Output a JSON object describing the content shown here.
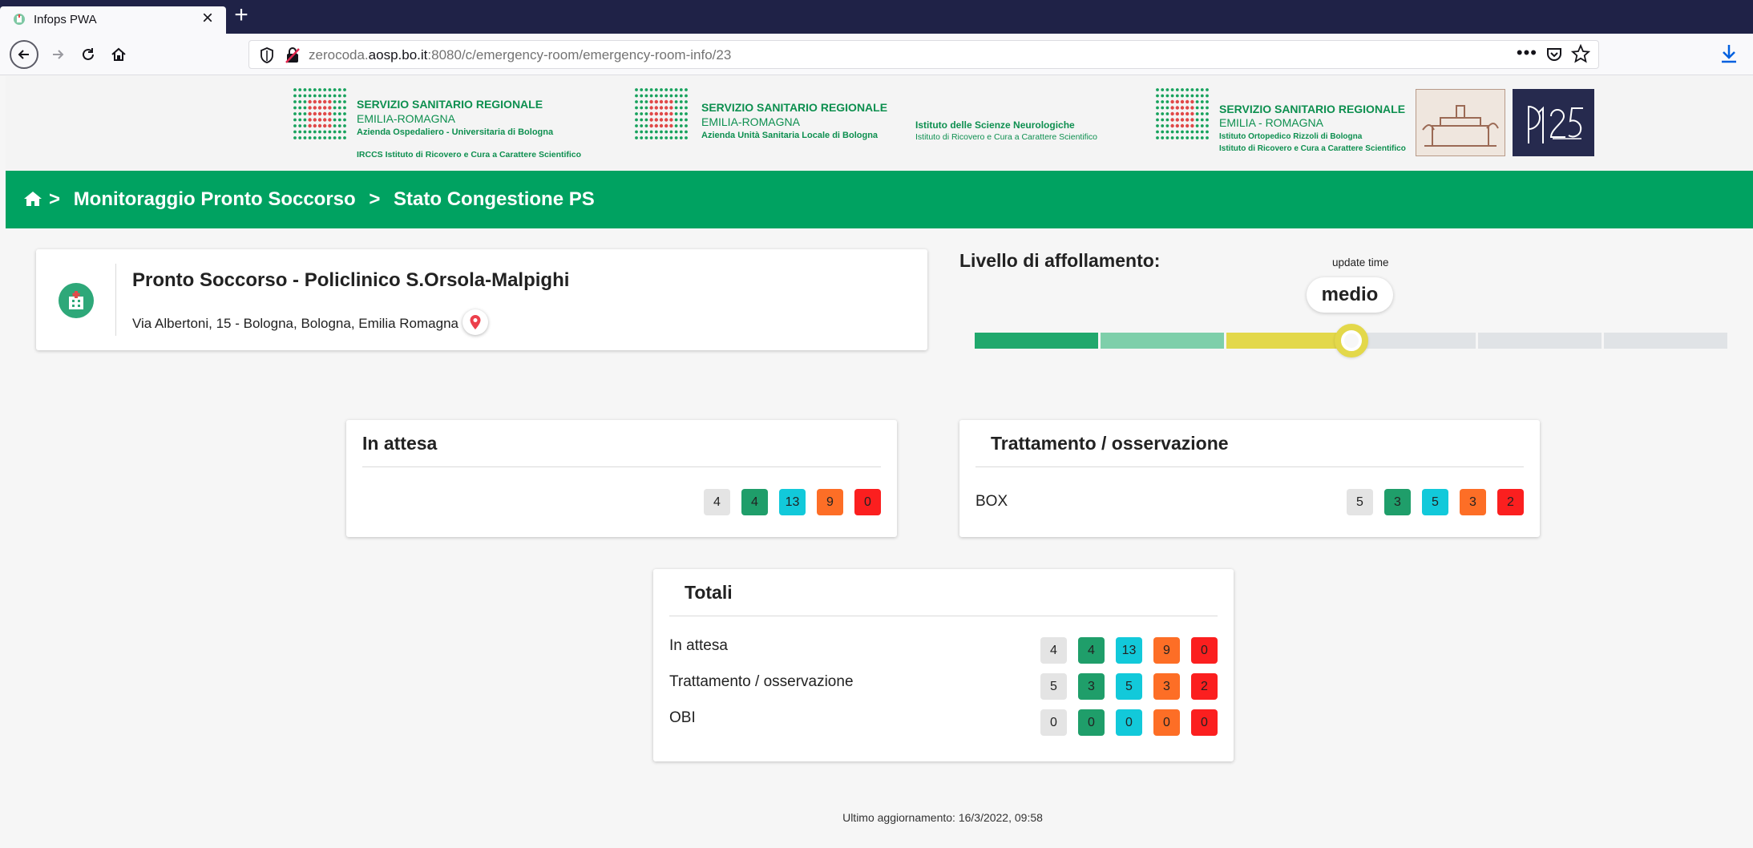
{
  "browser": {
    "tab_title": "Infops PWA",
    "url_prefix": "zerocoda.",
    "url_domain": "aosp.bo.it",
    "url_rest": ":8080/c/emergency-room/emergency-room-info/23",
    "more_label": "•••"
  },
  "logos": [
    {
      "line1": "SERVIZIO SANITARIO REGIONALE",
      "line2": "EMILIA-ROMAGNA",
      "line3": "Azienda Ospedaliero - Universitaria di Bologna",
      "line4": "IRCCS Istituto di Ricovero e Cura a Carattere Scientifico"
    },
    {
      "line1": "SERVIZIO SANITARIO REGIONALE",
      "line2": "EMILIA-ROMAGNA",
      "line3": "Azienda Unità Sanitaria Locale di Bologna",
      "neuro1": "Istituto delle Scienze Neurologiche",
      "neuro2": "Istituto di Ricovero e Cura a Carattere Scientifico"
    },
    {
      "line1": "SERVIZIO SANITARIO REGIONALE",
      "line2": "EMILIA - ROMAGNA",
      "line3": "Istituto Ortopedico Rizzoli di Bologna",
      "line4": "Istituto di Ricovero e Cura a Carattere Scientifico"
    }
  ],
  "breadcrumb": {
    "item1": "Monitoraggio Pronto Soccorso",
    "item2": "Stato Congestione PS",
    "separator": ">"
  },
  "hospital": {
    "name": "Pronto Soccorso - Policlinico S.Orsola-Malpighi",
    "address": "Via Albertoni, 15 - Bologna, Bologna, Emilia Romagna"
  },
  "crowding": {
    "title": "Livello di affollamento:",
    "update_label": "update time",
    "level_label": "medio",
    "level_fraction": 0.5,
    "segment_colors": [
      "#20a86d",
      "#7ecfaa",
      "#e3d84a",
      "#e0e3e6",
      "#e0e3e6",
      "#e0e3e6"
    ]
  },
  "colors": {
    "brand_green": "#00a261",
    "badge_grey": "#e4e4e4",
    "badge_green": "#1f9e6a",
    "badge_cyan": "#12c9da",
    "badge_orange": "#fd6e26",
    "badge_red": "#fb1f1f"
  },
  "in_attesa": {
    "title": "In attesa",
    "values": [
      "4",
      "4",
      "13",
      "9",
      "0"
    ]
  },
  "trattamento": {
    "title": "Trattamento / osservazione",
    "row_label": "BOX",
    "values": [
      "5",
      "3",
      "5",
      "3",
      "2"
    ]
  },
  "totali": {
    "title": "Totali",
    "rows": [
      {
        "label": "In attesa",
        "values": [
          "4",
          "4",
          "13",
          "9",
          "0"
        ]
      },
      {
        "label": "Trattamento / osservazione",
        "values": [
          "5",
          "3",
          "5",
          "3",
          "2"
        ]
      },
      {
        "label": "OBI",
        "values": [
          "0",
          "0",
          "0",
          "0",
          "0"
        ]
      }
    ]
  },
  "footer": {
    "last_update": "Ultimo aggiornamento: 16/3/2022, 09:58"
  }
}
